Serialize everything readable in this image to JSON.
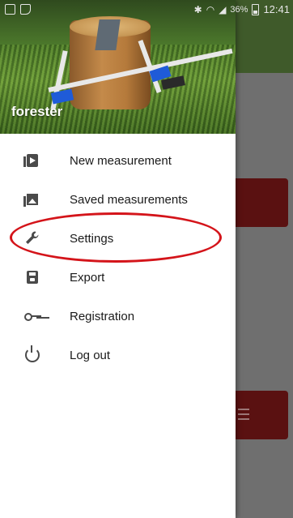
{
  "status_bar": {
    "battery_percent": "36%",
    "time": "12:41",
    "icons": [
      "screenshot-icon",
      "notification-icon",
      "bluetooth-icon",
      "wifi-icon",
      "signal-icon",
      "battery-icon"
    ]
  },
  "drawer": {
    "header": {
      "username": "forester"
    },
    "items": [
      {
        "label": "New measurement",
        "icon": "new-measurement-icon"
      },
      {
        "label": "Saved measurements",
        "icon": "gallery-icon"
      },
      {
        "label": "Settings",
        "icon": "wrench-icon"
      },
      {
        "label": "Export",
        "icon": "save-icon"
      },
      {
        "label": "Registration",
        "icon": "key-icon"
      },
      {
        "label": "Log out",
        "icon": "power-icon"
      }
    ]
  },
  "annotation": {
    "highlighted_item": "Settings",
    "color": "#d4141a"
  },
  "colors": {
    "accent": "#3f5a2a",
    "card": "#5a1111"
  }
}
